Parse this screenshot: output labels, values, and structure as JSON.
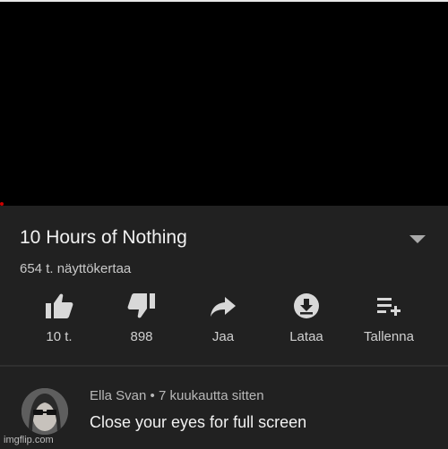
{
  "video": {
    "title": "10 Hours of Nothing",
    "views": "654 t. näyttökertaa"
  },
  "actions": [
    {
      "name": "like",
      "label": "10 t.",
      "icon": "thumbs-up-icon"
    },
    {
      "name": "dislike",
      "label": "898",
      "icon": "thumbs-down-icon"
    },
    {
      "name": "share",
      "label": "Jaa",
      "icon": "share-icon"
    },
    {
      "name": "download",
      "label": "Lataa",
      "icon": "download-icon"
    },
    {
      "name": "save",
      "label": "Tallenna",
      "icon": "playlist-add-icon"
    }
  ],
  "comment": {
    "author": "Ella Svan",
    "separator": "•",
    "time": "7 kuukautta sitten",
    "text": "Close your eyes for full screen"
  },
  "watermark": "imgflip.com",
  "colors": {
    "panel": "#212121",
    "text": "#f1f1f1",
    "icon": "#d8d8d8"
  }
}
